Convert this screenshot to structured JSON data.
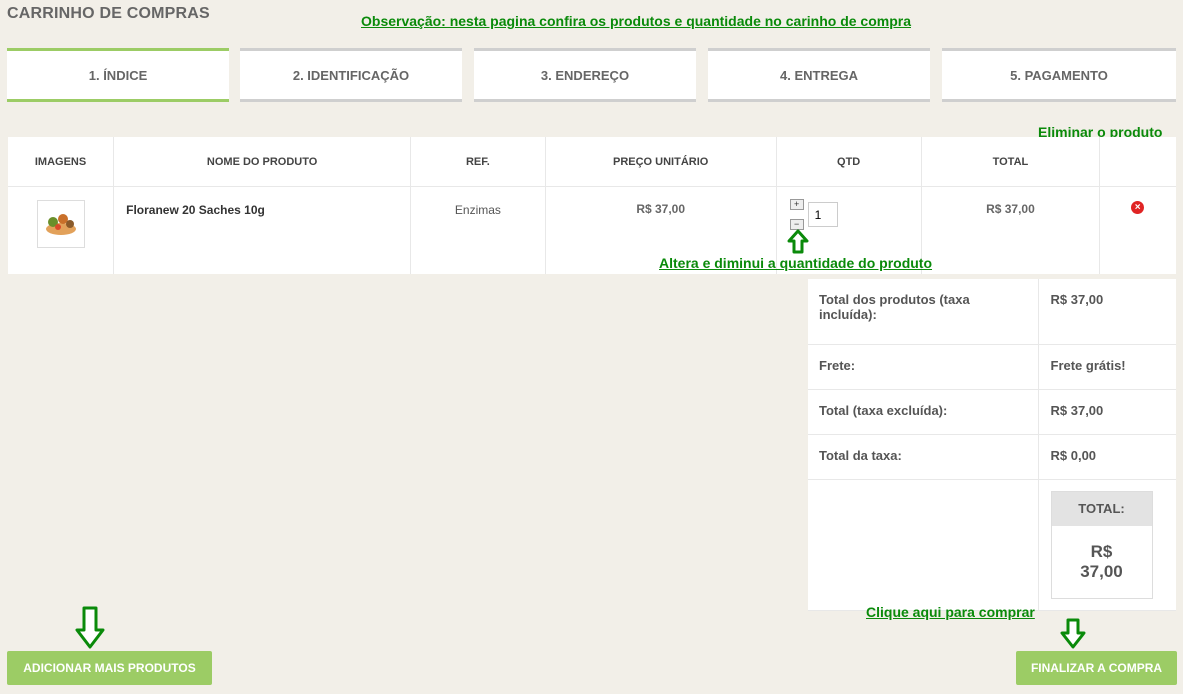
{
  "page": {
    "title": "CARRINHO DE COMPRAS"
  },
  "annotations": {
    "note": "Observação: nesta pagina confira os produtos e quantidade no carinho de compra",
    "remove_hint": "Eliminar o produto",
    "qty_hint": "Altera e diminui a quantidade do produto",
    "buy_hint": "Clique aqui para comprar"
  },
  "steps": [
    {
      "label": "1. ÍNDICE",
      "active": true
    },
    {
      "label": "2. IDENTIFICAÇÃO",
      "active": false
    },
    {
      "label": "3. ENDEREÇO",
      "active": false
    },
    {
      "label": "4. ENTREGA",
      "active": false
    },
    {
      "label": "5. PAGAMENTO",
      "active": false
    }
  ],
  "cart": {
    "headers": [
      "IMAGENS",
      "NOME DO PRODUTO",
      "REF.",
      "PREÇO UNITÁRIO",
      "QTD",
      "TOTAL"
    ],
    "items": [
      {
        "name": "Floranew 20 Saches 10g",
        "ref": "Enzimas",
        "unit_price": "R$ 37,00",
        "qty": "1",
        "total": "R$ 37,00",
        "increase": "+",
        "decrease": "−"
      }
    ]
  },
  "summary": {
    "rows": [
      {
        "label": "Total dos produtos (taxa incluída):",
        "value": "R$ 37,00"
      },
      {
        "label": "Frete:",
        "value": "Frete grátis!"
      },
      {
        "label": "Total (taxa excluída):",
        "value": "R$ 37,00"
      },
      {
        "label": "Total da taxa:",
        "value": "R$ 0,00"
      }
    ],
    "total_label": "TOTAL:",
    "total_value_line1": "R$",
    "total_value_line2": "37,00"
  },
  "buttons": {
    "add_more": "ADICIONAR MAIS PRODUTOS",
    "checkout": "FINALIZAR A COMPRA"
  },
  "icons": {
    "remove": "remove-icon",
    "arrow": "down-arrow-icon",
    "up_arrow": "up-arrow-icon"
  },
  "colors": {
    "accent": "#9ccc65",
    "annotation": "#0a8a0a",
    "remove": "#e02424"
  }
}
